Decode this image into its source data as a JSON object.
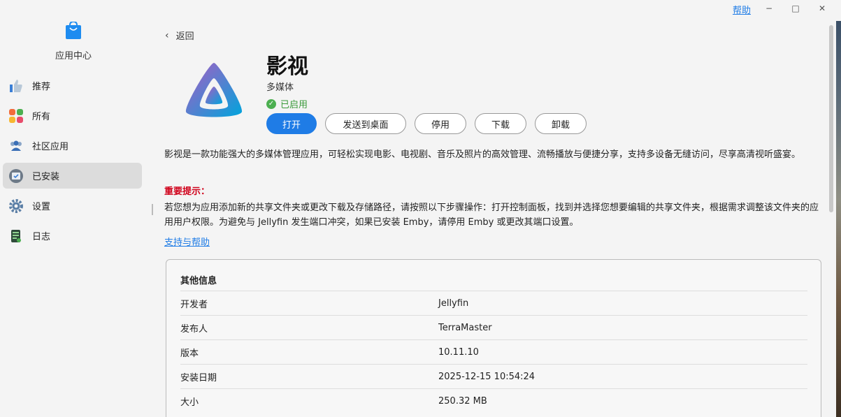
{
  "window": {
    "help_label": "帮助",
    "minimize": "−",
    "maximize": "□",
    "close": "✕"
  },
  "sidebar": {
    "app_name": "应用中心",
    "items": [
      {
        "label": "推荐",
        "icon": "thumbs-up-icon"
      },
      {
        "label": "所有",
        "icon": "grid-apps-icon"
      },
      {
        "label": "社区应用",
        "icon": "people-icon"
      },
      {
        "label": "已安装",
        "icon": "installed-icon",
        "active": true
      },
      {
        "label": "设置",
        "icon": "gear-icon"
      },
      {
        "label": "日志",
        "icon": "log-icon"
      }
    ]
  },
  "main": {
    "back_label": "返回",
    "app_title": "影视",
    "category": "多媒体",
    "status": "已启用",
    "buttons": {
      "open": "打开",
      "send_desktop": "发送到桌面",
      "disable": "停用",
      "download": "下载",
      "uninstall": "卸载"
    },
    "description": "影视是一款功能强大的多媒体管理应用，可轻松实现电影、电视剧、音乐及照片的高效管理、流畅播放与便捷分享，支持多设备无缝访问，尽享高清视听盛宴。",
    "notice_title": "重要提示：",
    "notice_text": "若您想为应用添加新的共享文件夹或更改下载及存储路径，请按照以下步骤操作：打开控制面板，找到并选择您想要编辑的共享文件夹，根据需求调整该文件夹的应用用户权限。为避免与 Jellyfin 发生端口冲突，如果已安装 Emby，请停用 Emby 或更改其端口设置。",
    "support_link": "支持与帮助"
  },
  "info": {
    "title": "其他信息",
    "rows": [
      {
        "key": "开发者",
        "value": "Jellyfin"
      },
      {
        "key": "发布人",
        "value": "TerraMaster"
      },
      {
        "key": "版本",
        "value": "10.11.10"
      },
      {
        "key": "安装日期",
        "value": "2025-12-15 10:54:24"
      },
      {
        "key": "大小",
        "value": "250.32 MB"
      }
    ]
  },
  "colors": {
    "accent": "#1f7ce6",
    "warning": "#d0021b",
    "success": "#4caf50"
  }
}
